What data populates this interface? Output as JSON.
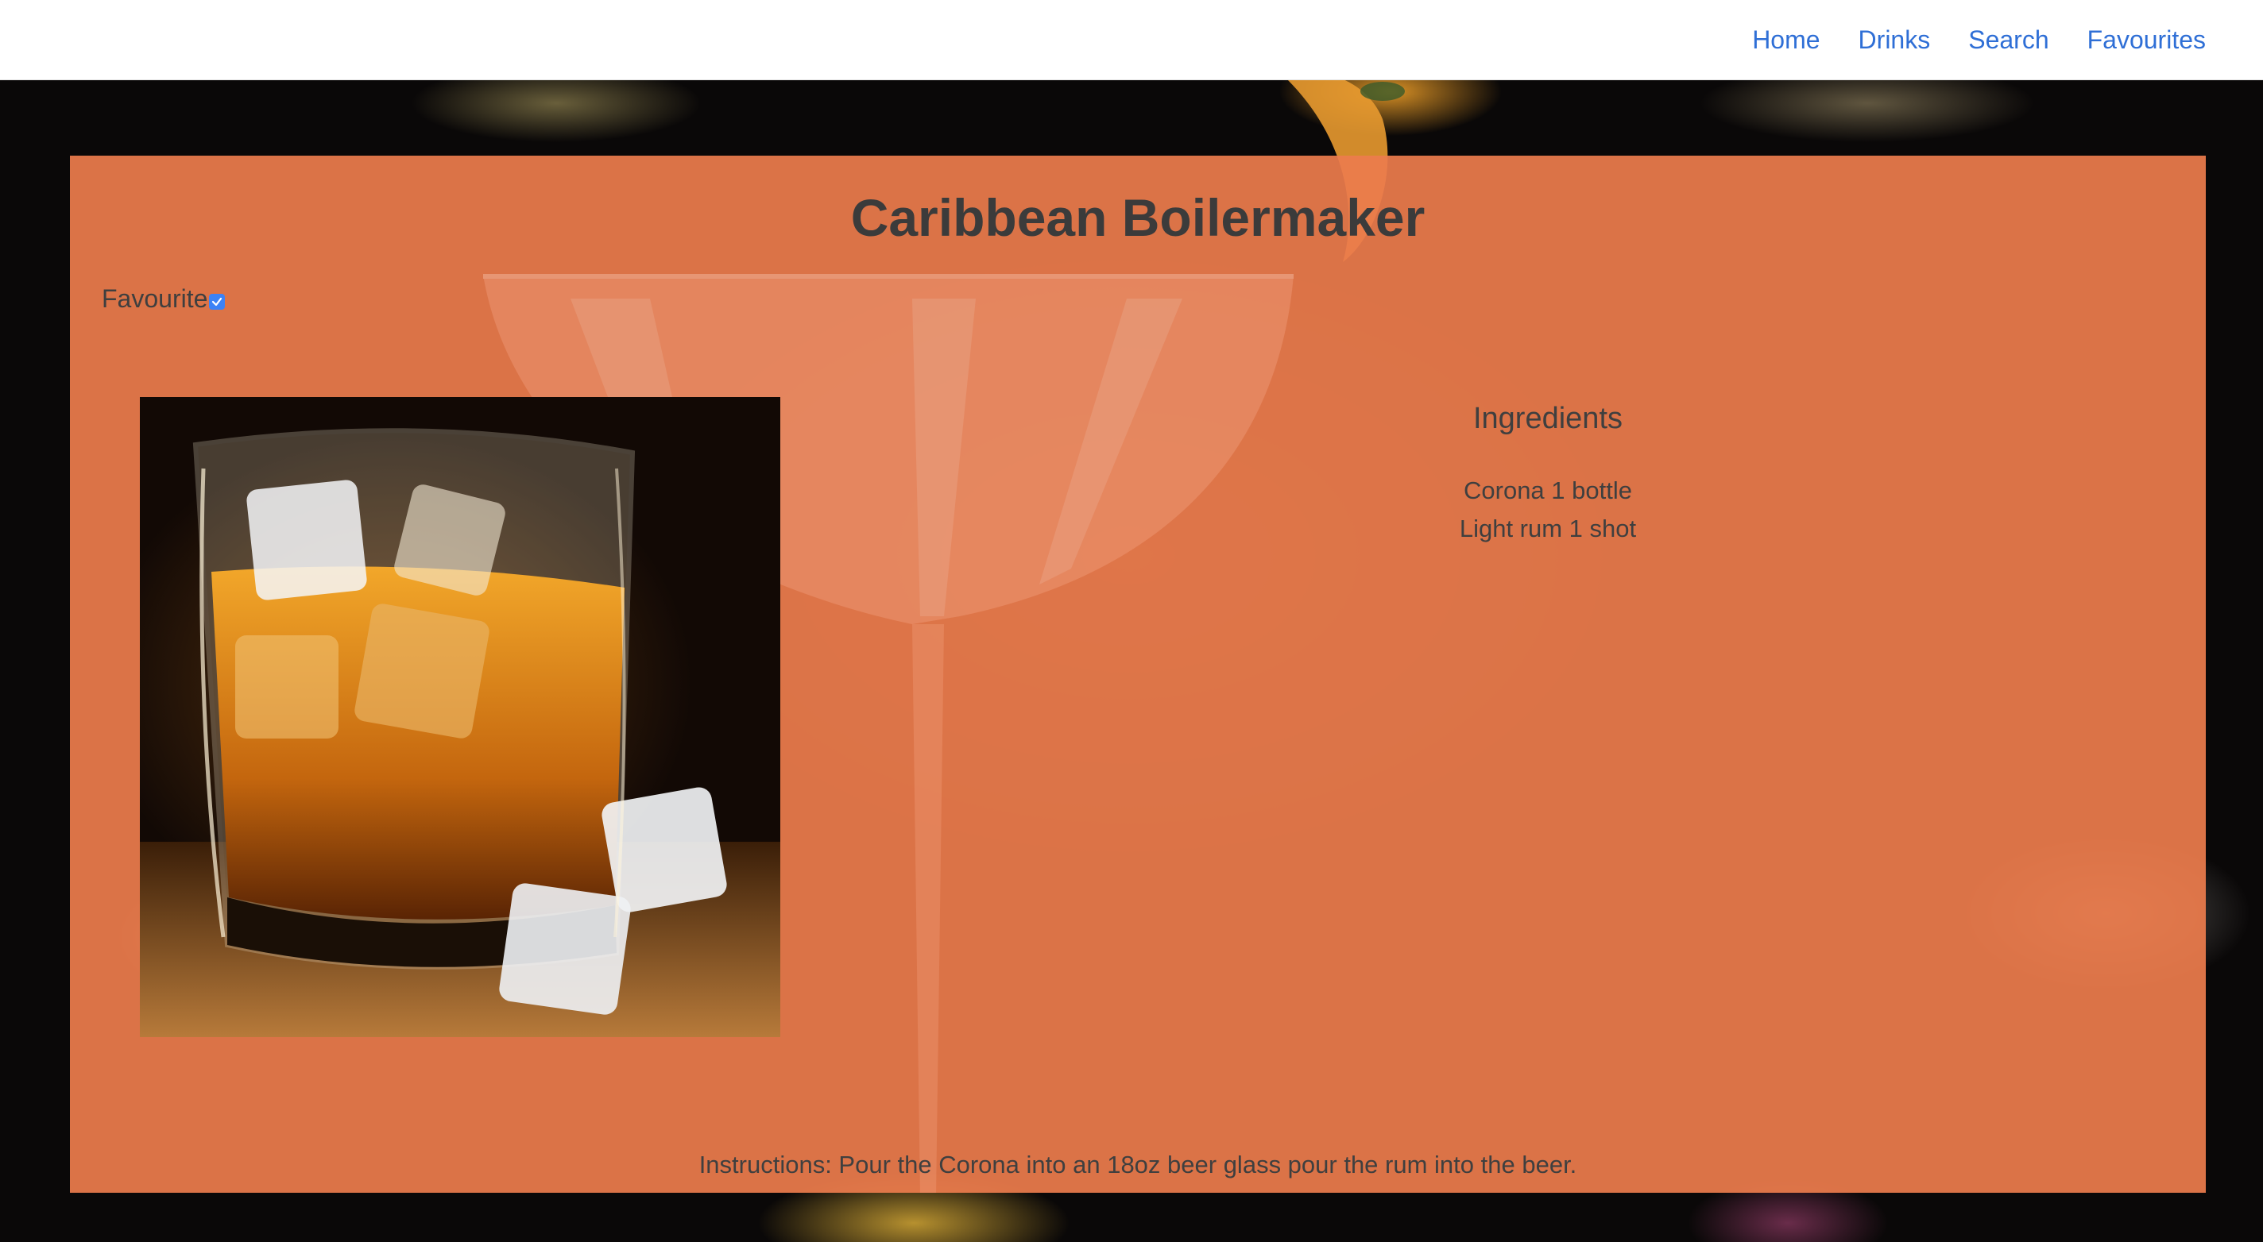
{
  "nav": {
    "links": [
      "Home",
      "Drinks",
      "Search",
      "Favourites"
    ]
  },
  "drink": {
    "title": "Caribbean Boilermaker",
    "favourite_label": "Favourite",
    "favourite_checked": true,
    "ingredients_heading": "Ingredients",
    "ingredients": [
      "Corona 1 bottle",
      "Light rum 1 shot"
    ],
    "instructions": "Instructions: Pour the Corona into an 18oz beer glass pour the rum into the beer."
  },
  "colors": {
    "nav_link": "#2f6fd6",
    "card_overlay": "#ec7c4c",
    "text": "#3f3f3f",
    "checkbox": "#3b82f6"
  },
  "icons": {
    "checkbox": "checkmark-icon"
  }
}
